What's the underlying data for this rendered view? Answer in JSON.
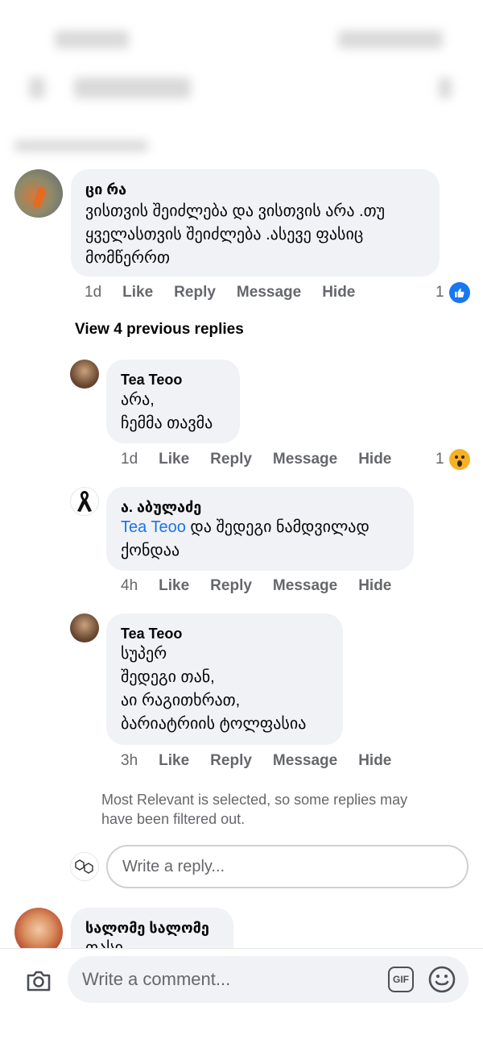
{
  "comments": {
    "main": {
      "author": "ცი რა",
      "text": "ვისთვის შეიძლება და ვისთვის არა .თუ ყველასთვის შეიძლება .ასევე ფასიც მომწერრთ",
      "time": "1d",
      "reaction_count": "1"
    },
    "view_previous": "View 4 previous replies",
    "replies": [
      {
        "author": "Tea Teoo",
        "text": "არა,\nჩემმა თავმა",
        "time": "1d",
        "reaction_count": "1"
      },
      {
        "author": "ა. აბულაძე",
        "mention": "Tea Teoo",
        "text": " და შედეგი ნამდვილად ქონდაა",
        "time": "4h"
      },
      {
        "author": "Tea Teoo",
        "text": "სუპერ\nშედეგი თან,\nაი რაგითხრათ,\nბარიატრიის ტოლფასია",
        "time": "3h"
      }
    ],
    "filter_note": "Most Relevant is selected, so some replies may have been filtered out.",
    "reply_placeholder": "Write a reply...",
    "next": {
      "author": "სალომე სალომე",
      "text": "თასი"
    }
  },
  "actions": {
    "like": "Like",
    "reply": "Reply",
    "message": "Message",
    "hide": "Hide"
  },
  "composer": {
    "placeholder": "Write a comment...",
    "gif": "GIF"
  },
  "colors": {
    "like_blue": "#1877f2",
    "mention_blue": "#1b74e4",
    "bubble_bg": "#f0f2f5",
    "meta_gray": "#65676b"
  }
}
